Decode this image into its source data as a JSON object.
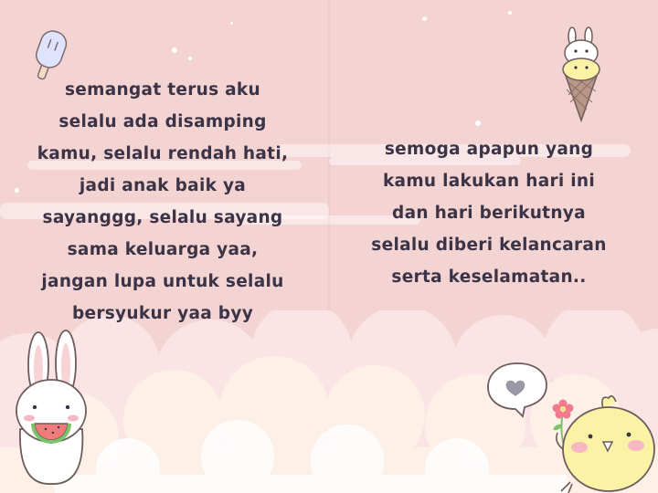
{
  "left_message": {
    "lines": [
      "semangat terus aku",
      "selalu ada disamping",
      "kamu, selalu rendah hati,",
      "jadi anak baik ya",
      "sayanggg, selalu sayang",
      "sama keluarga yaa,",
      "jangan lupa untuk selalu",
      "bersyukur yaa byy"
    ]
  },
  "right_message": {
    "lines": [
      "semoga apapun yang",
      "kamu lakukan hari ini",
      "dan hari berikutnya",
      "selalu diberi kelancaran",
      "serta keselamatan.."
    ]
  },
  "colors": {
    "background": "#f4d3d3",
    "text": "#3b3346",
    "cloud_light": "#fbe9ea",
    "cloud_cream": "#fdf1e7"
  },
  "icons": [
    "popsicle-icon",
    "bunny-ice-cream-icon",
    "bunny-watermelon-icon",
    "heart-speech-bubble-icon",
    "flower-icon",
    "chick-icon"
  ]
}
